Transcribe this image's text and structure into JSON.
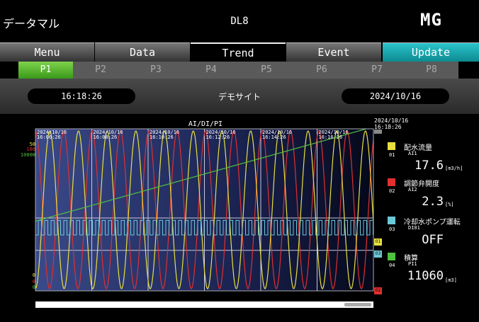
{
  "header": {
    "app_title": "データマル",
    "device": "DL8",
    "logo": "MG"
  },
  "main_tabs": [
    {
      "label": "Menu"
    },
    {
      "label": "Data"
    },
    {
      "label": "Trend"
    },
    {
      "label": "Event"
    },
    {
      "label": "Update"
    }
  ],
  "active_main_tab": "Trend",
  "sub_tabs": [
    "P1",
    "P2",
    "P3",
    "P4",
    "P5",
    "P6",
    "P7",
    "P8"
  ],
  "active_sub_tab": "P1",
  "info": {
    "time": "16:18:26",
    "site": "デモサイト",
    "date": "2024/10/16"
  },
  "chart": {
    "title": "AI/DI/PI",
    "cursor_date": "2024/10/16",
    "cursor_time": "16:18:26",
    "time_ticks": [
      {
        "date": "2024/10/16",
        "time": "16:06:26"
      },
      {
        "date": "2024/10/16",
        "time": "16:08:26"
      },
      {
        "date": "2024/10/16",
        "time": "16:10:26"
      },
      {
        "date": "2024/10/16",
        "time": "16:12:26"
      },
      {
        "date": "2024/10/16",
        "time": "16:14:26"
      },
      {
        "date": "2024/10/16",
        "time": "16:16:26"
      }
    ],
    "y_max_labels": [
      {
        "text": "50",
        "color": "#e8e040"
      },
      {
        "text": "100",
        "color": "#e03030"
      },
      {
        "text": "10000",
        "color": "#50c040"
      }
    ],
    "y_min_labels": [
      {
        "text": "0",
        "color": "#e8e040"
      },
      {
        "text": "0",
        "color": "#e03030"
      },
      {
        "text": "0",
        "color": "#50c040"
      }
    ],
    "end_markers": [
      {
        "text": "01",
        "color": "#e8e040"
      },
      {
        "text": "03",
        "color": "#6cc8d8"
      },
      {
        "text": "02",
        "color": "#e03030"
      }
    ]
  },
  "channels": [
    {
      "no": "01",
      "color": "#e8e040",
      "name": "配水流量",
      "tag": "AI1",
      "value": "17.6",
      "unit": "[m3/h]"
    },
    {
      "no": "02",
      "color": "#e03030",
      "name": "調節弁開度",
      "tag": "AI2",
      "value": "2.3",
      "unit": "[%]"
    },
    {
      "no": "03",
      "color": "#6cc8d8",
      "name": "冷却水ポンプ運転",
      "tag": "DI01",
      "value": "OFF",
      "unit": ""
    },
    {
      "no": "04",
      "color": "#50c040",
      "name": "積算",
      "tag": "PI1",
      "value": "11060",
      "unit": "[m3]"
    }
  ]
}
